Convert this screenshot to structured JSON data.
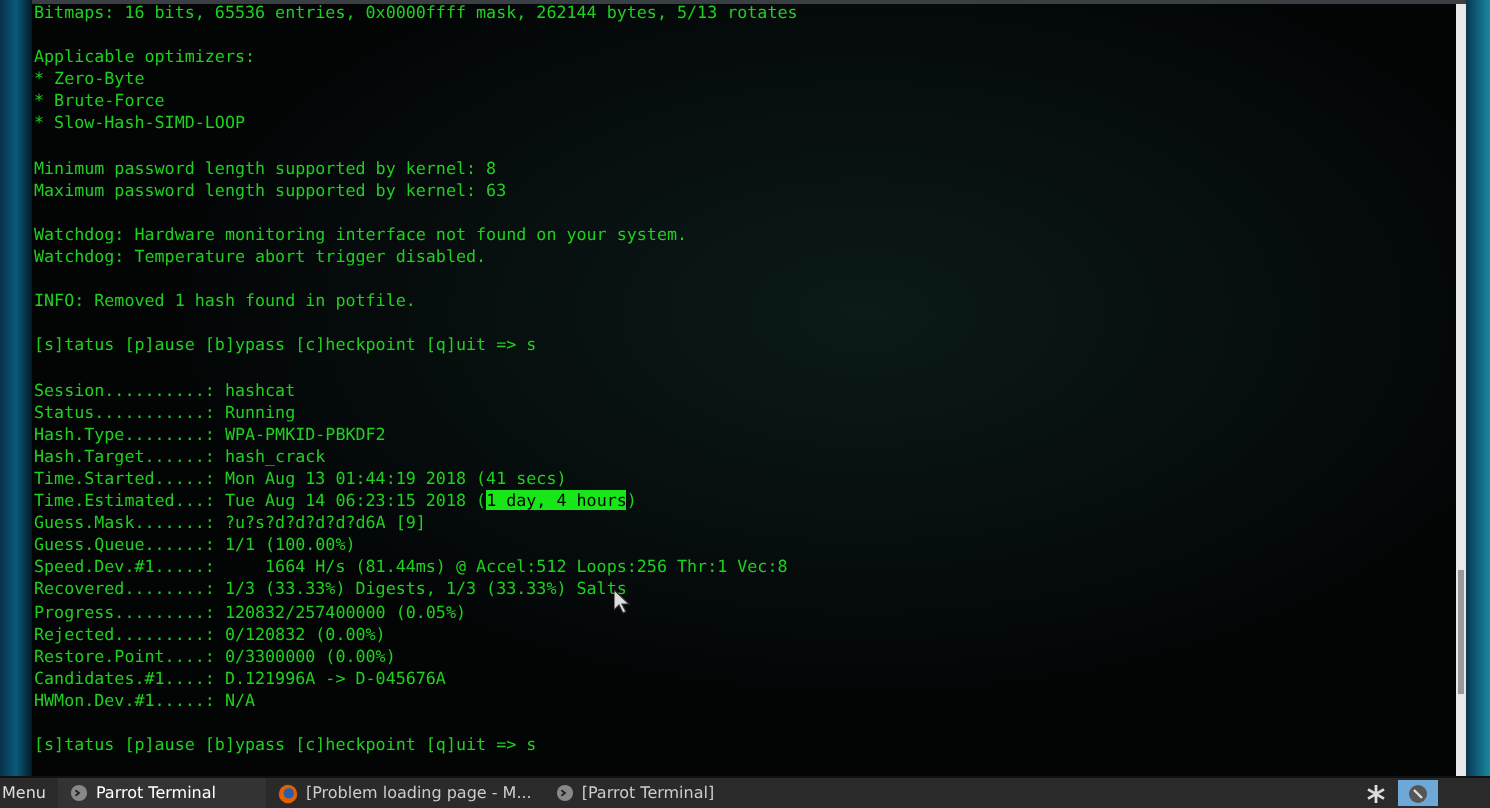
{
  "terminal": {
    "blocks": [
      {
        "lines": [
          {
            "parts": [
              {
                "text": "Bitmaps: 16 bits, 65536 entries, 0x0000ffff mask, 262144 bytes, 5/13 rotates",
                "highlight": false
              }
            ]
          }
        ]
      },
      {
        "lines": [
          {
            "parts": [
              {
                "text": "Applicable optimizers:",
                "highlight": false
              }
            ]
          },
          {
            "parts": [
              {
                "text": "* Zero-Byte",
                "highlight": false
              }
            ]
          },
          {
            "parts": [
              {
                "text": "* Brute-Force",
                "highlight": false
              }
            ]
          },
          {
            "parts": [
              {
                "text": "* Slow-Hash-SIMD-LOOP",
                "highlight": false
              }
            ]
          }
        ]
      },
      {
        "lines": [
          {
            "parts": [
              {
                "text": "Minimum password length supported by kernel: 8",
                "highlight": false
              }
            ]
          },
          {
            "parts": [
              {
                "text": "Maximum password length supported by kernel: 63",
                "highlight": false
              }
            ]
          }
        ]
      },
      {
        "lines": [
          {
            "parts": [
              {
                "text": "Watchdog: Hardware monitoring interface not found on your system.",
                "highlight": false
              }
            ]
          },
          {
            "parts": [
              {
                "text": "Watchdog: Temperature abort trigger disabled.",
                "highlight": false
              }
            ]
          }
        ]
      },
      {
        "lines": [
          {
            "parts": [
              {
                "text": "INFO: Removed 1 hash found in potfile.",
                "highlight": false
              }
            ]
          }
        ]
      },
      {
        "lines": [
          {
            "parts": [
              {
                "text": "[s]tatus [p]ause [b]ypass [c]heckpoint [q]uit => s",
                "highlight": false
              }
            ]
          }
        ]
      },
      {
        "lines": [
          {
            "parts": [
              {
                "text": "Session..........: hashcat",
                "highlight": false
              }
            ]
          },
          {
            "parts": [
              {
                "text": "Status...........: Running",
                "highlight": false
              }
            ]
          },
          {
            "parts": [
              {
                "text": "Hash.Type........: WPA-PMKID-PBKDF2",
                "highlight": false
              }
            ]
          },
          {
            "parts": [
              {
                "text": "Hash.Target......: hash_crack",
                "highlight": false
              }
            ]
          },
          {
            "parts": [
              {
                "text": "Time.Started.....: Mon Aug 13 01:44:19 2018 (41 secs)",
                "highlight": false
              }
            ]
          },
          {
            "parts": [
              {
                "text": "Time.Estimated...: Tue Aug 14 06:23:15 2018 (",
                "highlight": false
              },
              {
                "text": "1 day, 4 hours",
                "highlight": true
              },
              {
                "text": ")",
                "highlight": false
              }
            ]
          },
          {
            "parts": [
              {
                "text": "Guess.Mask.......: ?u?s?d?d?d?d?d6A [9]",
                "highlight": false
              }
            ]
          },
          {
            "parts": [
              {
                "text": "Guess.Queue......: 1/1 (100.00%)",
                "highlight": false
              }
            ]
          },
          {
            "parts": [
              {
                "text": "Speed.Dev.#1.....:     1664 H/s (81.44ms) @ Accel:512 Loops:256 Thr:1 Vec:8",
                "highlight": false
              }
            ]
          },
          {
            "parts": [
              {
                "text": "Recovered........: 1/3 (33.33%) Digests, 1/3 (33.33%) Salts",
                "highlight": false
              }
            ]
          },
          {
            "parts": [
              {
                "text": "Progress.........: 120832/257400000 (0.05%)",
                "highlight": false
              }
            ]
          },
          {
            "parts": [
              {
                "text": "Rejected.........: 0/120832 (0.00%)",
                "highlight": false
              }
            ]
          },
          {
            "parts": [
              {
                "text": "Restore.Point....: 0/3300000 (0.00%)",
                "highlight": false
              }
            ]
          },
          {
            "parts": [
              {
                "text": "Candidates.#1....: D.121996A -> D-045676A",
                "highlight": false
              }
            ]
          },
          {
            "parts": [
              {
                "text": "HWMon.Dev.#1.....: N/A",
                "highlight": false
              }
            ]
          }
        ]
      },
      {
        "lines": [
          {
            "parts": [
              {
                "text": "[s]tatus [p]ause [b]ypass [c]heckpoint [q]uit => s",
                "highlight": false
              }
            ]
          }
        ]
      }
    ]
  },
  "taskbar": {
    "menu": "Menu",
    "windows": [
      {
        "kind": "terminal",
        "title": "Parrot Terminal",
        "selected": true
      },
      {
        "kind": "browser",
        "title": "[Problem loading page - M...",
        "selected": false
      },
      {
        "kind": "terminal",
        "title": "[Parrot Terminal]",
        "selected": false
      }
    ]
  }
}
